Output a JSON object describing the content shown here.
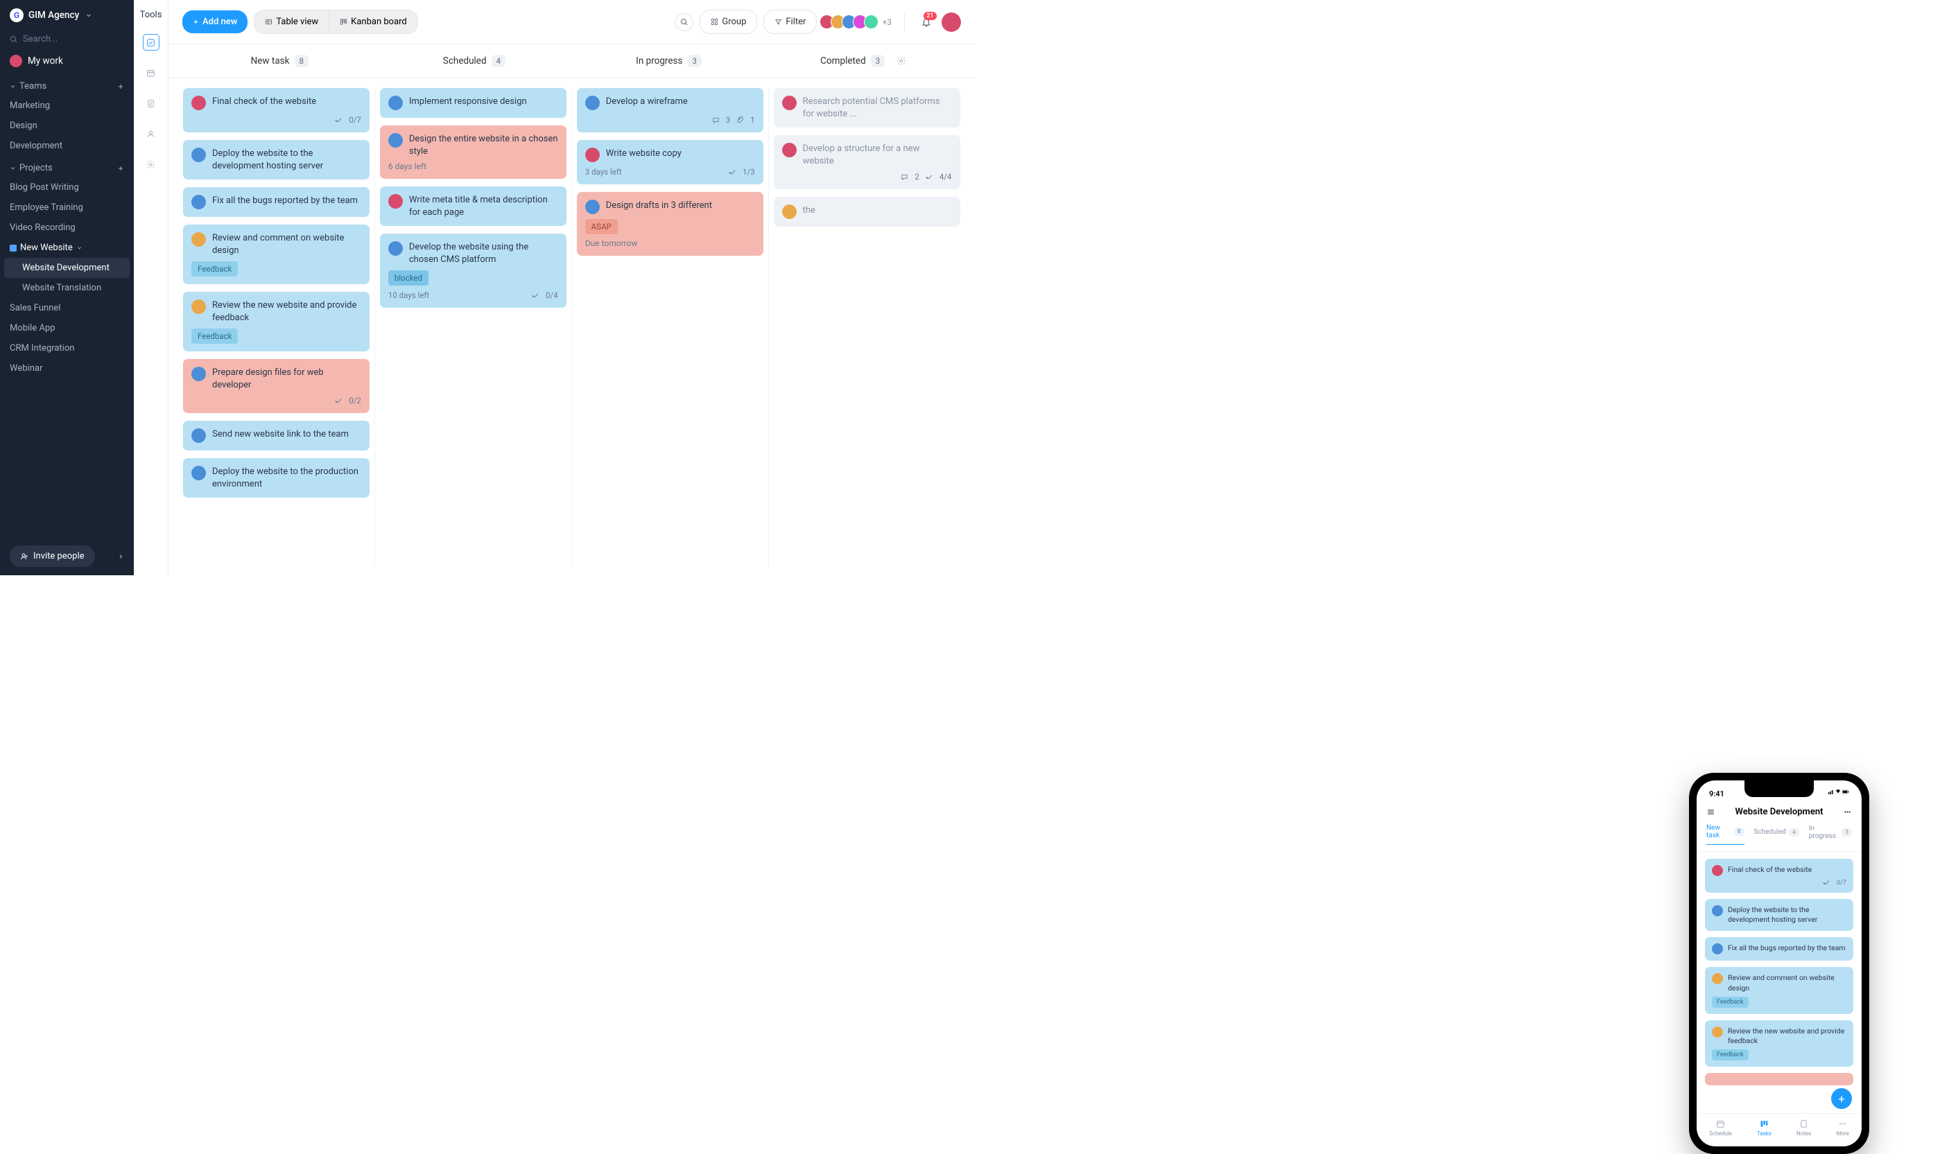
{
  "org": {
    "initial": "G",
    "name": "GIM Agency"
  },
  "search_placeholder": "Search...",
  "mywork": "My work",
  "teams": {
    "label": "Teams",
    "items": [
      "Marketing",
      "Design",
      "Development"
    ]
  },
  "projects": {
    "label": "Projects",
    "items": [
      "Blog Post Writing",
      "Employee Training",
      "Video Recording"
    ],
    "expanded": {
      "name": "New Website",
      "children": [
        "Website Development",
        "Website Translation"
      ],
      "active": "Website Development"
    },
    "more": [
      "Sales Funnel",
      "Mobile App",
      "CRM Integration",
      "Webinar"
    ]
  },
  "invite": "Invite people",
  "iconbar_label": "Tools",
  "toolbar": {
    "add": "Add new",
    "table": "Table view",
    "kanban": "Kanban board",
    "group": "Group",
    "filter": "Filter",
    "more": "+3",
    "notif": "21"
  },
  "columns": [
    {
      "name": "New task",
      "count": "8"
    },
    {
      "name": "Scheduled",
      "count": "4"
    },
    {
      "name": "In progress",
      "count": "3"
    },
    {
      "name": "Completed",
      "count": "3"
    }
  ],
  "cards": {
    "newtask": [
      {
        "title": "Final check of the website",
        "av": "av1",
        "color": "blue",
        "check": "0/7"
      },
      {
        "title": "Deploy the website to the development hosting server",
        "av": "av3",
        "color": "blue"
      },
      {
        "title": "Fix all the bugs reported by the team",
        "av": "av3",
        "color": "blue"
      },
      {
        "title": "Review and comment on website design",
        "av": "av2",
        "color": "blue",
        "tag": "Feedback",
        "tagClass": "feedback"
      },
      {
        "title": "Review the new website and provide feedback",
        "av": "av2",
        "color": "blue",
        "tag": "Feedback",
        "tagClass": "feedback"
      },
      {
        "title": "Prepare design files for web developer",
        "av": "av3",
        "color": "red",
        "check": "0/2"
      },
      {
        "title": "Send new website link to the team",
        "av": "av3",
        "color": "blue"
      },
      {
        "title": "Deploy the website to the production environment",
        "av": "av3",
        "color": "blue"
      }
    ],
    "scheduled": [
      {
        "title": "Implement responsive design",
        "av": "av3",
        "color": "blue"
      },
      {
        "title": "Design the entire website in a chosen style",
        "av": "av3",
        "color": "red",
        "due": "6 days left"
      },
      {
        "title": "Write meta title & meta description for each page",
        "av": "av1",
        "color": "blue"
      },
      {
        "title": "Develop the website using the chosen CMS platform",
        "av": "av3",
        "color": "blue",
        "tag": "blocked",
        "tagClass": "blocked",
        "due": "10 days left",
        "check": "0/4"
      }
    ],
    "inprogress": [
      {
        "title": "Develop a wireframe",
        "av": "av3",
        "color": "blue",
        "comments": "3",
        "attach": "1"
      },
      {
        "title": "Write website copy",
        "av": "av1",
        "color": "blue",
        "due": "3 days left",
        "check": "1/3"
      },
      {
        "title": "Design drafts in 3 different",
        "av": "av3",
        "color": "red",
        "tag": "ASAP",
        "tagClass": "asap",
        "due": "Due tomorrow"
      }
    ],
    "completed": [
      {
        "title": "Research potential CMS platforms for website ...",
        "av": "av1"
      },
      {
        "title": "Develop a structure for a new website",
        "av": "av1",
        "comments": "2",
        "check": "4/4"
      },
      {
        "title": "the",
        "av": "av2",
        "partial": true
      }
    ]
  },
  "phone": {
    "time": "9:41",
    "title": "Website Development",
    "tabs": [
      {
        "name": "New task",
        "count": "8"
      },
      {
        "name": "Scheduled",
        "count": "4"
      },
      {
        "name": "In progress",
        "count": "3"
      }
    ],
    "cards": [
      {
        "title": "Final check of the website",
        "av": "av1",
        "color": "blue",
        "check": "0/7"
      },
      {
        "title": "Deploy the website to the development hosting server",
        "av": "av3",
        "color": "blue"
      },
      {
        "title": "Fix all the bugs reported by the team",
        "av": "av3",
        "color": "blue"
      },
      {
        "title": "Review and comment on website design",
        "av": "av2",
        "color": "blue",
        "tag": "Feedback",
        "tagClass": "feedback"
      },
      {
        "title": "Review the new website and provide feedback",
        "av": "av2",
        "color": "blue",
        "tag": "Feedback",
        "tagClass": "feedback"
      }
    ],
    "nav": [
      "Schedule",
      "Tasks",
      "Notes",
      "More"
    ]
  }
}
